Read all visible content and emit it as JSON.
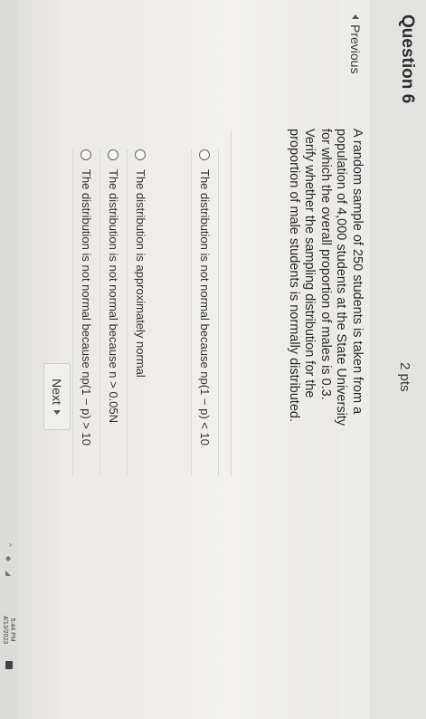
{
  "question": {
    "title": "Question 6",
    "points": "2 pts",
    "text": "A random sample of 250 students is taken from a population of 4,000 students at the State University for which the overall proportion of males is 0.3. Verify whether the sampling distribution for the proportion of male students is normally distributed."
  },
  "options": [
    {
      "text": "The distribution is not normal because np(1 − p) < 10"
    },
    {
      "text": "The distribution is approximately normal"
    },
    {
      "text": "The distribution is not normal because n > 0.05N"
    },
    {
      "text": "The distribution is not normal because np(1 − p) > 10"
    }
  ],
  "nav": {
    "previous_label": "Previous",
    "next_label": "Next"
  },
  "taskbar": {
    "time": "5:44 PM",
    "date": "4/13/2023"
  },
  "icons": {
    "previous": "triangle-left-icon",
    "next": "triangle-right-icon",
    "radio": "radio-button-icon",
    "notification": "notification-icon"
  }
}
